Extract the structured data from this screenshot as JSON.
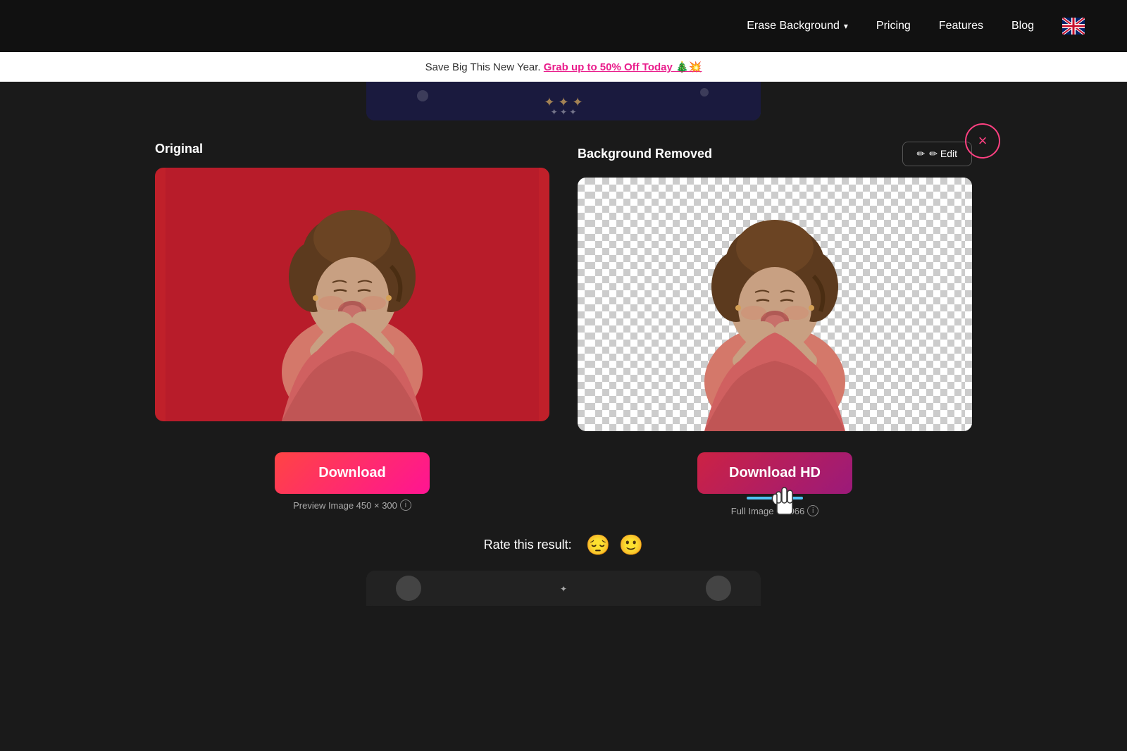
{
  "header": {
    "nav": [
      {
        "label": "Erase Background",
        "hasDropdown": true
      },
      {
        "label": "Pricing"
      },
      {
        "label": "Features"
      },
      {
        "label": "Blog"
      }
    ]
  },
  "promo": {
    "text": "Save Big This New Year. ",
    "linkText": "Grab up to 50% Off Today 🎄💥"
  },
  "main": {
    "original_label": "Original",
    "removed_label": "Background Removed",
    "edit_btn": "✏ Edit",
    "download_btn": "Download",
    "download_hd_btn": "Download HD",
    "preview_info": "Preview Image 450 × 300",
    "full_info": "Full Image × 1066",
    "rate_label": "Rate this result:",
    "sad_emoji": "😔",
    "neutral_emoji": "🙂"
  },
  "close_icon": "×",
  "icons": {
    "chevron_down": "▾",
    "pencil": "✏",
    "info": "i"
  }
}
